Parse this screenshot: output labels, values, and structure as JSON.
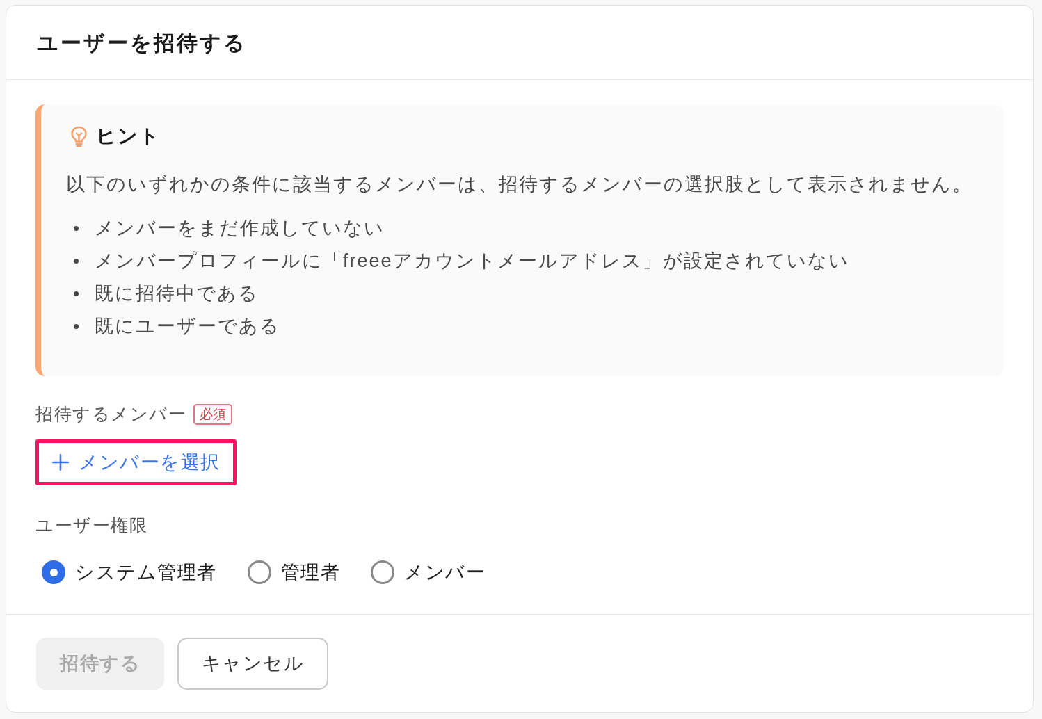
{
  "dialog": {
    "title": "ユーザーを招待する"
  },
  "hint": {
    "title": "ヒント",
    "message": "以下のいずれかの条件に該当するメンバーは、招待するメンバーの選択肢として表示されません。",
    "items": [
      "メンバーをまだ作成していない",
      "メンバープロフィールに「freeeアカウントメールアドレス」が設定されていない",
      "既に招待中である",
      "既にユーザーである"
    ]
  },
  "members_field": {
    "label": "招待するメンバー",
    "required_badge": "必須",
    "add_button": {
      "label": "メンバーを選択",
      "highlighted": true
    }
  },
  "role_field": {
    "label": "ユーザー権限",
    "options": [
      {
        "label": "システム管理者",
        "selected": true
      },
      {
        "label": "管理者",
        "selected": false
      },
      {
        "label": "メンバー",
        "selected": false
      }
    ]
  },
  "footer": {
    "buttons": [
      {
        "label": "招待する",
        "kind": "primary",
        "disabled": true
      },
      {
        "label": "キャンセル",
        "kind": "secondary",
        "disabled": false
      }
    ]
  }
}
